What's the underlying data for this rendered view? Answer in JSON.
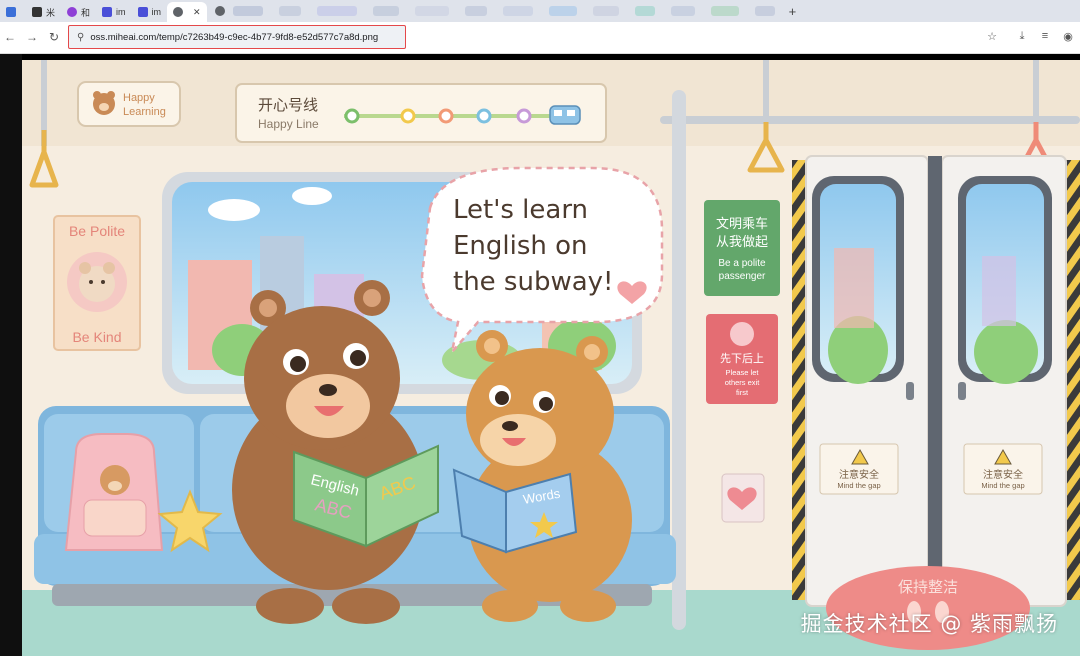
{
  "browser": {
    "tabs": [
      {
        "title": "",
        "icon": "window-icon",
        "color": "#3b6fd8"
      },
      {
        "title": "米",
        "icon": "doc-icon",
        "color": "#222222"
      },
      {
        "title": "和",
        "icon": "ai-icon",
        "color": "#8e3fd6"
      },
      {
        "title": "im",
        "icon": "app-icon",
        "color": "#4a4fd8"
      },
      {
        "title": "im",
        "icon": "app-icon",
        "color": "#4a4fd8"
      }
    ],
    "active_tab_close": "✕",
    "address": "oss.miheai.com/temp/c7263b49-c9ec-4b77-9fd8-e52d577c7a8d.png"
  },
  "scene": {
    "route_cn": "开心号线",
    "route_en": "Happy Line",
    "brand": [
      "Happy",
      "Learning"
    ],
    "poster_top": "Be Polite",
    "poster_bottom": "Be Kind",
    "speech": [
      "Let's learn",
      "English on",
      "the subway!"
    ],
    "courtesy_cn": [
      "文明乘车",
      "从我做起"
    ],
    "courtesy_en": [
      "Be a polite",
      "passenger"
    ],
    "exit_cn": "先下后上",
    "exit_en": [
      "Please let",
      "others exit",
      "first"
    ],
    "gap_cn": "注意安全",
    "gap_en": "Mind the gap",
    "floor_cn": "保持整洁",
    "book_left": [
      "English",
      "ABC",
      "ABC"
    ],
    "book_right": "Words",
    "colors": {
      "wall": "#f6ede0",
      "seat": "#8fc3e6",
      "floor": "#a9d9cd",
      "sign_green": "#63a76b",
      "sign_red": "#e46d73"
    }
  },
  "watermark": "掘金技术社区 @ 紫雨飘扬"
}
